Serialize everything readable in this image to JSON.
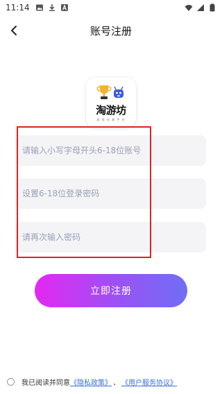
{
  "status_bar": {
    "time": "11:14",
    "left_icons": [
      "image-icon",
      "download-icon",
      "a-badge-icon"
    ],
    "right_icons": [
      "wifi-icon",
      "signal-icon",
      "battery-icon"
    ]
  },
  "nav": {
    "back_icon": "chevron-left-icon",
    "title": "账号注册"
  },
  "logo": {
    "name": "淘游坊",
    "tagline": "游 戏 交 易 平 台"
  },
  "form": {
    "account_placeholder": "请输入小写字母开头6-18位账号",
    "account_value": "",
    "password_placeholder": "设置6-18位登录密码",
    "password_value": "",
    "confirm_placeholder": "请再次输入密码",
    "confirm_value": ""
  },
  "register_button": "立即注册",
  "agreement": {
    "checked": false,
    "prefix": "我已阅读并同意",
    "privacy_link": "《隐私政策》",
    "separator": "、",
    "terms_link": "《用户服务协议》"
  },
  "colors": {
    "button_gradient_start": "#e428f2",
    "button_gradient_end": "#6f6ff5",
    "link": "#3a6fd8",
    "highlight": "#e02020",
    "input_bg": "#f4f4f6"
  }
}
